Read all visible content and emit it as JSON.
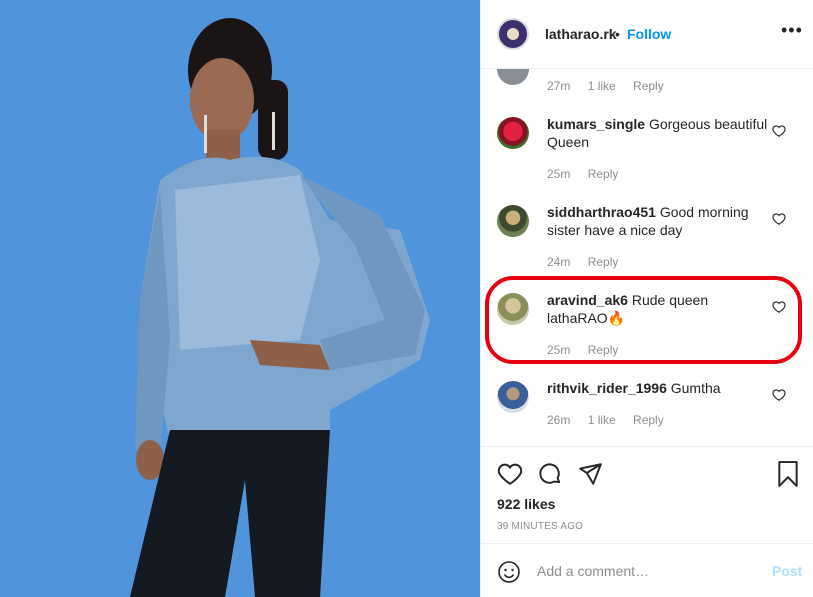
{
  "photo": {
    "bg_color": "#4a8fd9"
  },
  "header": {
    "username": "latharao.rk",
    "separator": "•",
    "follow_label": "Follow",
    "more_label": "•••"
  },
  "comments": [
    {
      "username": "",
      "text": "",
      "time": "27m",
      "likes": "1 like",
      "reply": "Reply"
    },
    {
      "username": "kumars_single",
      "text": "Gorgeous beautiful Queen",
      "time": "25m",
      "likes": "",
      "reply": "Reply"
    },
    {
      "username": "siddharthrao451",
      "text": "Good morning sister have a nice day",
      "time": "24m",
      "likes": "",
      "reply": "Reply"
    },
    {
      "username": "aravind_ak6",
      "text": "Rude queen lathaRAO🔥",
      "time": "25m",
      "likes": "",
      "reply": "Reply"
    },
    {
      "username": "rithvik_rider_1996",
      "text": "Gumtha",
      "time": "26m",
      "likes": "1 like",
      "reply": "Reply"
    }
  ],
  "actions": {
    "likes": "922 likes",
    "time": "39 MINUTES AGO"
  },
  "add_comment": {
    "placeholder": "Add a comment…",
    "post_label": "Post"
  },
  "colors": {
    "highlight": "#e8000e",
    "link": "#0095f6"
  }
}
